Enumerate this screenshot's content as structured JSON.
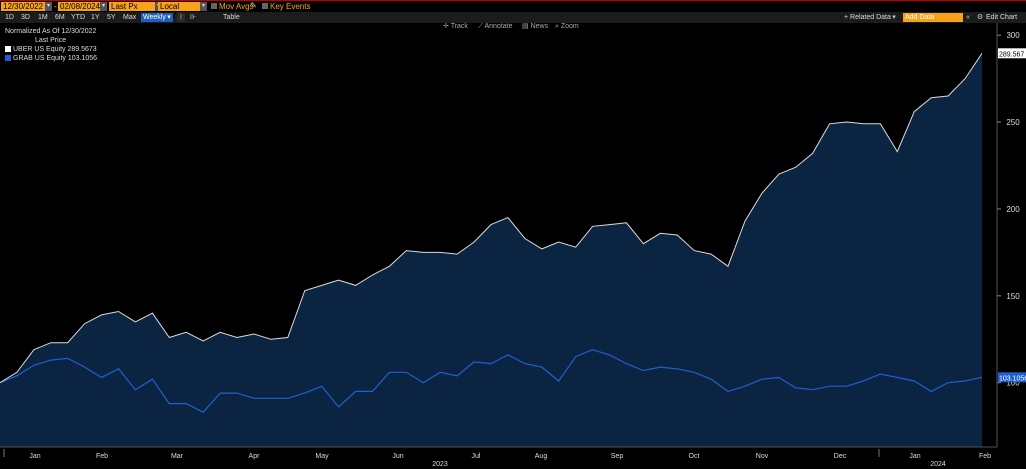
{
  "toolbar": {
    "start_date": "12/30/2022",
    "end_date": "02/08/2024",
    "date_separator": "-",
    "field": "Last Px",
    "currency": "Local CCY",
    "mov_avgs": "Mov Avgs",
    "key_events": "Key Events",
    "periods": [
      "1D",
      "3D",
      "1M",
      "6M",
      "YTD",
      "1Y",
      "5Y",
      "Max"
    ],
    "frequency": "Weekly",
    "table": "Table",
    "related_data": "+ Related Data",
    "add_data_placeholder": "Add Data",
    "edit_chart": "Edit Chart",
    "collapse": "«",
    "gear": "⚙"
  },
  "chart_tools": {
    "track": "Track",
    "annotate": "Annotate",
    "news": "News",
    "zoom": "Zoom"
  },
  "legend": {
    "line1": "Normalized As Of 12/30/2022",
    "line2": "Last Price",
    "uber": "UBER US Equity 289.5673",
    "grab": "GRAB US Equity 103.1056"
  },
  "colors": {
    "background": "#000000",
    "uber_line": "#dcdcdc",
    "area_fill": "#0b2442",
    "grab_line": "#1f5fd0",
    "accent": "#f7a21b"
  },
  "chart_data": {
    "type": "line",
    "title": "",
    "ylabel": "",
    "xlabel": "",
    "ylim": [
      63,
      307
    ],
    "y_ticks": [
      100,
      150,
      200,
      250,
      300
    ],
    "grid": false,
    "x_tick_labels": [
      "Jan",
      "Feb",
      "Mar",
      "Apr",
      "May",
      "Jun",
      "Jul",
      "Aug",
      "Sep",
      "Oct",
      "Nov",
      "Dec",
      "Jan",
      "Feb"
    ],
    "year_labels": [
      "2023",
      "2024"
    ],
    "series": [
      {
        "name": "UBER US Equity",
        "last_value_label": "289.567",
        "values": [
          100,
          106,
          119,
          123,
          123,
          134,
          139,
          141,
          135,
          140,
          126,
          129,
          124,
          129,
          126,
          128,
          125,
          126,
          153,
          156,
          159,
          156,
          162,
          167,
          176,
          175,
          175,
          174,
          181,
          191,
          195,
          183,
          177,
          181,
          178,
          190,
          191,
          192,
          180,
          186,
          185,
          176,
          174,
          167,
          193,
          209,
          220,
          224,
          232,
          249,
          250,
          249,
          249,
          233,
          256,
          264,
          265,
          275,
          289.5673
        ]
      },
      {
        "name": "GRAB US Equity",
        "last_value_label": "103.1056",
        "values": [
          100,
          104,
          110,
          113,
          114,
          109,
          103,
          108,
          96,
          102,
          88,
          88,
          83,
          94,
          94,
          91,
          91,
          91,
          94,
          98,
          86,
          95,
          95,
          106,
          106,
          100,
          106,
          104,
          112,
          111,
          116,
          111,
          109,
          101,
          115,
          119,
          116,
          111,
          107,
          109,
          108,
          106,
          102,
          95,
          98,
          102,
          103,
          97,
          96,
          98,
          98,
          101,
          105,
          103,
          101,
          95,
          100,
          101,
          103.1056
        ]
      }
    ]
  }
}
